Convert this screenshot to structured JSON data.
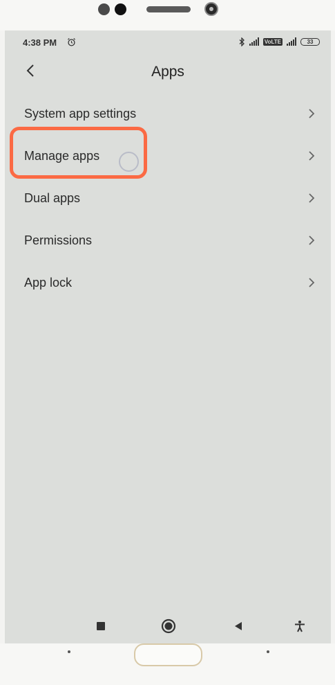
{
  "status_bar": {
    "time": "4:38 PM",
    "lte_label": "VoLTE",
    "battery": "33"
  },
  "header": {
    "title": "Apps"
  },
  "menu": {
    "items": [
      {
        "label": "System app settings"
      },
      {
        "label": "Manage apps"
      },
      {
        "label": "Dual apps"
      },
      {
        "label": "Permissions"
      },
      {
        "label": "App lock"
      }
    ]
  },
  "colors": {
    "highlight": "#fb6a44",
    "screen_bg": "#dcdedb"
  },
  "icons": {
    "back": "chevron-left-icon",
    "item_arrow": "chevron-right-icon",
    "alarm": "alarm-icon",
    "nav": [
      "recents-square-icon",
      "home-circle-icon",
      "back-triangle-icon",
      "accessibility-icon"
    ]
  }
}
